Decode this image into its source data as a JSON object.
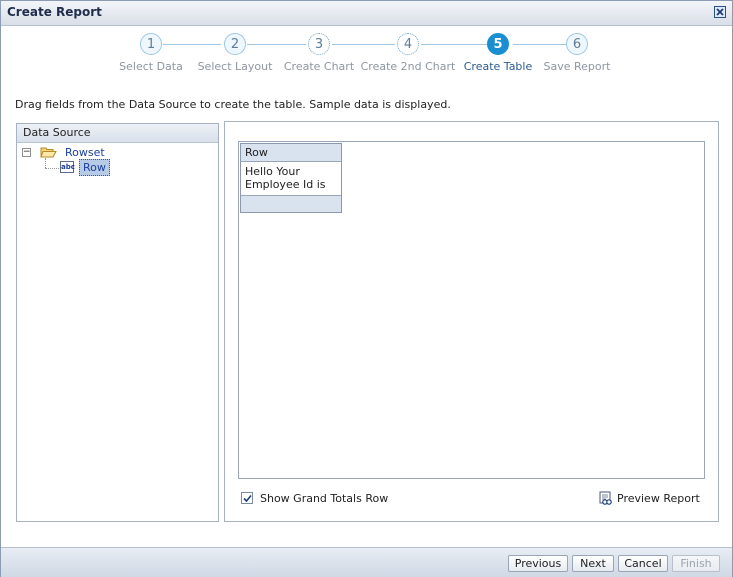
{
  "window": {
    "title": "Create Report"
  },
  "train": {
    "steps": [
      {
        "num": "1",
        "label": "Select Data"
      },
      {
        "num": "2",
        "label": "Select Layout"
      },
      {
        "num": "3",
        "label": "Create Chart"
      },
      {
        "num": "4",
        "label": "Create 2nd Chart"
      },
      {
        "num": "5",
        "label": "Create Table"
      },
      {
        "num": "6",
        "label": "Save Report"
      }
    ],
    "current": "5"
  },
  "instruction": "Drag fields from the Data Source to create the table. Sample data is displayed.",
  "data_source": {
    "header": "Data Source",
    "expander": "−",
    "folder_label": "Rowset",
    "field_icon": "abc",
    "field_label": "Row"
  },
  "table": {
    "column_header": "Row",
    "cell_line1": "Hello Your",
    "cell_line2": "Employee Id is"
  },
  "options": {
    "grand_totals_label": "Show Grand Totals Row",
    "grand_totals_checked": true,
    "preview_label": "Preview Report"
  },
  "footer": {
    "previous": "Previous",
    "next": "Next",
    "cancel": "Cancel",
    "finish": "Finish"
  },
  "icons": {
    "close": "close-icon",
    "folder": "folder-open-icon",
    "text_field": "text-field-icon",
    "checkbox": "checkbox-checked-icon",
    "preview": "preview-report-icon"
  },
  "colors": {
    "accent": "#1a8ed1",
    "step_border": "#9ec7e3",
    "link_text": "#1b3f9c"
  }
}
